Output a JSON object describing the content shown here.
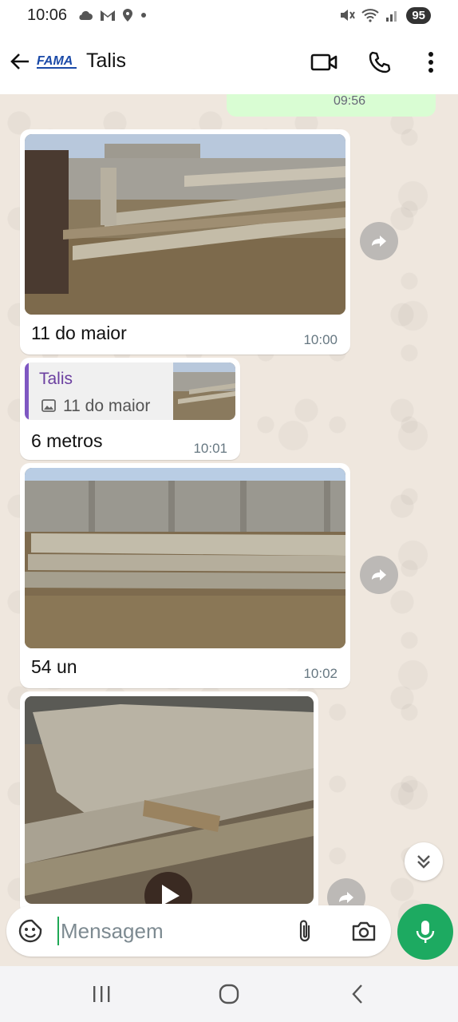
{
  "status_bar": {
    "time": "10:06",
    "battery": "95"
  },
  "header": {
    "logo_text": "FAMA",
    "contact_name": "Talis"
  },
  "colors": {
    "accent": "#1daa61",
    "outgoing_bubble": "#d9fdd3",
    "quote_bar": "#7e57c2"
  },
  "messages": [
    {
      "type": "outgoing-partial",
      "time": "09:56"
    },
    {
      "type": "image",
      "caption": "11 do maior",
      "time": "10:00"
    },
    {
      "type": "reply",
      "quoted_sender": "Talis",
      "quoted_text": "11 do maior",
      "text": "6 metros",
      "time": "10:01"
    },
    {
      "type": "image",
      "caption": "54 un",
      "time": "10:02"
    },
    {
      "type": "video"
    }
  ],
  "composer": {
    "placeholder": "Mensagem"
  },
  "icons": {
    "back": "arrow-left-icon",
    "video_call": "video-camera-icon",
    "call": "phone-icon",
    "menu": "more-vertical-icon",
    "forward": "forward-icon",
    "scroll_down": "double-chevron-down-icon",
    "sticker": "sticker-icon",
    "attach": "paperclip-icon",
    "camera": "camera-icon",
    "mic": "microphone-icon"
  }
}
